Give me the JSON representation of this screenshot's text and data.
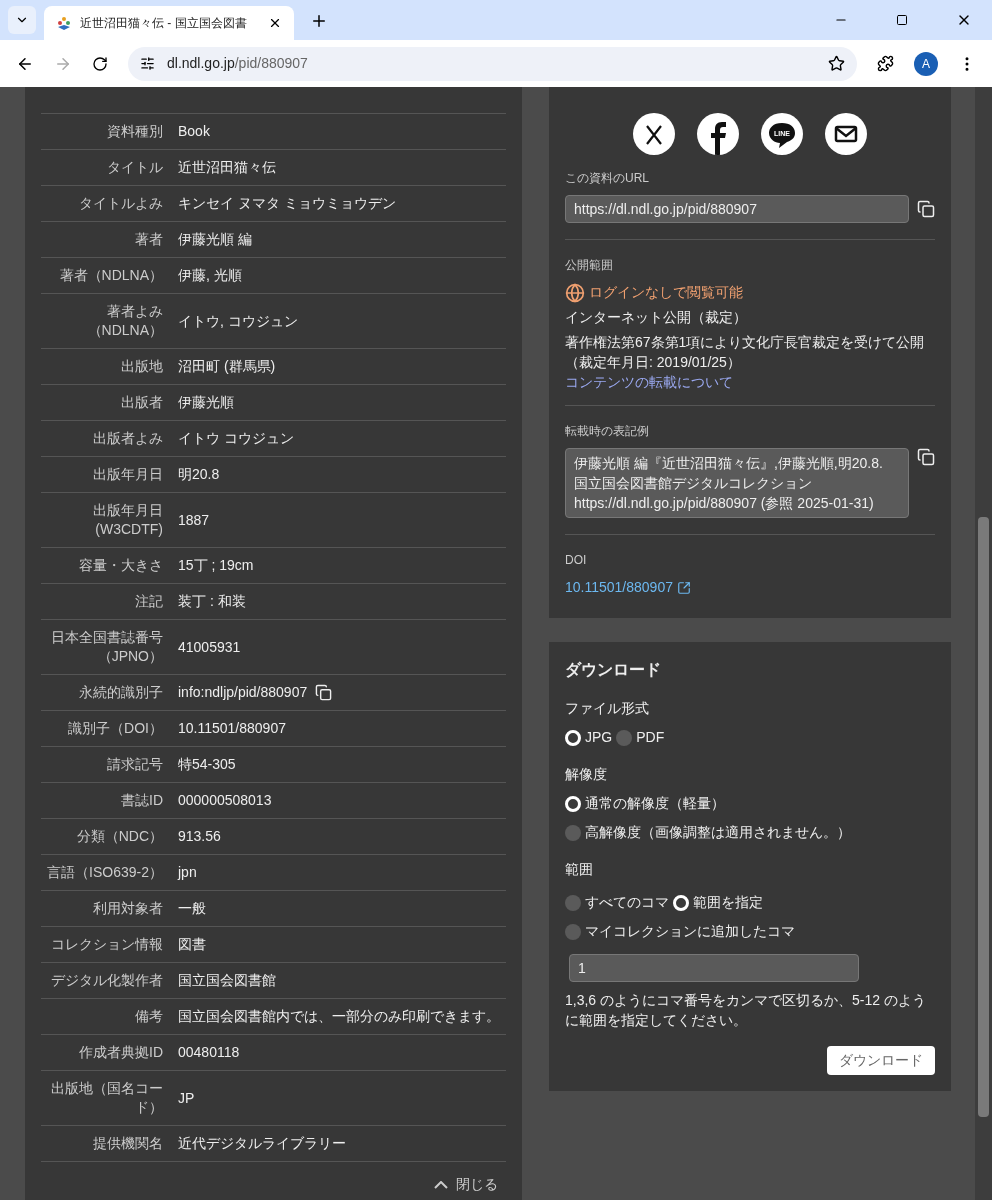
{
  "browser": {
    "tab_title": "近世沼田猫々伝 - 国立国会図書",
    "url_host": "dl.ndl.go.jp",
    "url_path": "/pid/880907",
    "profile_initial": "A"
  },
  "bibliography": {
    "rows": [
      {
        "label": "資料種別",
        "value": "Book"
      },
      {
        "label": "タイトル",
        "value": "近世沼田猫々伝"
      },
      {
        "label": "タイトルよみ",
        "value": "キンセイ ヌマタ ミョウミョウデン"
      },
      {
        "label": "著者",
        "value": "伊藤光順 編"
      },
      {
        "label": "著者（NDLNA）",
        "value": "伊藤, 光順"
      },
      {
        "label": "著者よみ（NDLNA）",
        "value": "イトウ, コウジュン"
      },
      {
        "label": "出版地",
        "value": "沼田町 (群馬県)"
      },
      {
        "label": "出版者",
        "value": "伊藤光順"
      },
      {
        "label": "出版者よみ",
        "value": "イトウ コウジュン"
      },
      {
        "label": "出版年月日",
        "value": "明20.8"
      },
      {
        "label": "出版年月日(W3CDTF)",
        "value": "1887"
      },
      {
        "label": "容量・大きさ",
        "value": "15丁 ; 19cm"
      },
      {
        "label": "注記",
        "value": "装丁 : 和装"
      },
      {
        "label": "日本全国書誌番号（JPNO）",
        "value": "41005931"
      },
      {
        "label": "永続的識別子",
        "value": "info:ndljp/pid/880907",
        "copyable": true
      },
      {
        "label": "識別子（DOI）",
        "value": "10.11501/880907"
      },
      {
        "label": "請求記号",
        "value": "特54-305"
      },
      {
        "label": "書誌ID",
        "value": "000000508013"
      },
      {
        "label": "分類（NDC）",
        "value": "913.56"
      },
      {
        "label": "言語（ISO639-2）",
        "value": "jpn"
      },
      {
        "label": "利用対象者",
        "value": "一般"
      },
      {
        "label": "コレクション情報",
        "value": "図書"
      },
      {
        "label": "デジタル化製作者",
        "value": "国立国会図書館"
      },
      {
        "label": "備考",
        "value": "国立国会図書館内では、一部分のみ印刷できます。"
      },
      {
        "label": "作成者典拠ID",
        "value": "00480118"
      },
      {
        "label": "出版地（国名コード）",
        "value": "JP"
      },
      {
        "label": "提供機関名",
        "value": "近代デジタルライブラリー"
      }
    ],
    "collapse_label": "閉じる"
  },
  "share": {
    "buttons": [
      {
        "kind": "x"
      },
      {
        "kind": "facebook"
      },
      {
        "kind": "line",
        "logo_text": "LINE"
      },
      {
        "kind": "mail"
      }
    ],
    "url_label": "この資料のURL",
    "url": "https://dl.ndl.go.jp/pid/880907",
    "access_label": "公開範囲",
    "access_status": "ログインなしで閲覧可能",
    "access_type": "インターネット公開（裁定）",
    "access_note": "著作権法第67条第1項により文化庁長官裁定を受けて公開（裁定年月日: 2019/01/25）",
    "reuse_link": "コンテンツの転載について",
    "citation_label": "転載時の表記例",
    "citation": "伊藤光順 編『近世沼田猫々伝』,伊藤光順,明20.8. 国立国会図書館デジタルコレクション https://dl.ndl.go.jp/pid/880907 (参照 2025-01-31)",
    "doi_label": "DOI",
    "doi": "10.11501/880907"
  },
  "download": {
    "title": "ダウンロード",
    "format_label": "ファイル形式",
    "formats": [
      {
        "label": "JPG",
        "selected": true
      },
      {
        "label": "PDF",
        "selected": false
      }
    ],
    "resolution_label": "解像度",
    "resolutions": [
      {
        "label": "通常の解像度（軽量）",
        "selected": true
      },
      {
        "label": "高解像度（画像調整は適用されません。）",
        "selected": false
      }
    ],
    "range_label": "範囲",
    "ranges": [
      {
        "label": "すべてのコマ",
        "selected": false
      },
      {
        "label": "範囲を指定",
        "selected": true
      },
      {
        "label": "マイコレクションに追加したコマ",
        "selected": false
      }
    ],
    "range_value": "1",
    "hint": "1,3,6 のようにコマ番号をカンマで区切るか、5-12 のように範囲を指定してください。",
    "button": "ダウンロード"
  }
}
